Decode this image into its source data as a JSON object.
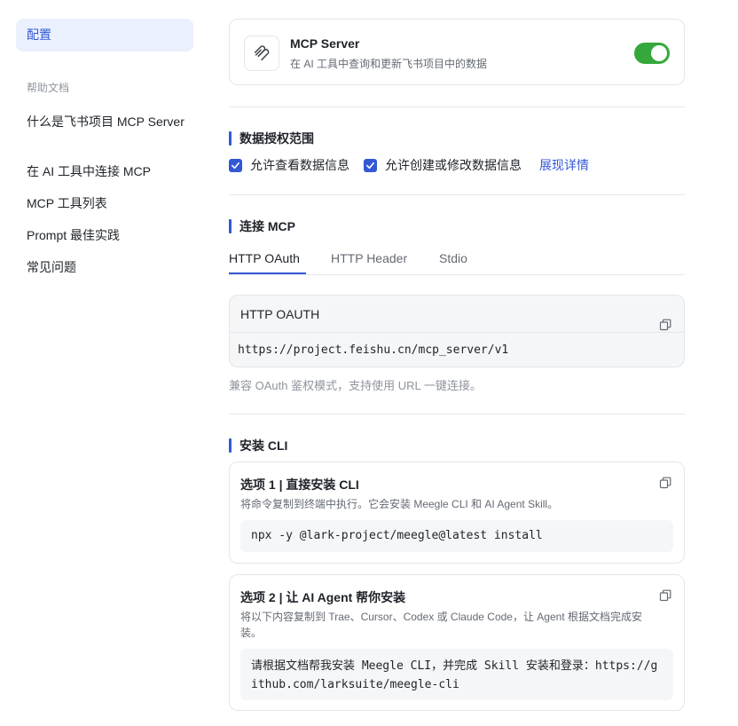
{
  "sidebar": {
    "active_item": "配置",
    "group_title": "帮助文档",
    "items": [
      {
        "label": "什么是飞书项目 MCP Server"
      },
      {
        "label": "在 AI 工具中连接 MCP"
      },
      {
        "label": "MCP 工具列表"
      },
      {
        "label": "Prompt 最佳实践"
      },
      {
        "label": "常见问题"
      }
    ]
  },
  "server": {
    "title": "MCP Server",
    "description": "在 AI 工具中查询和更新飞书项目中的数据",
    "enabled": true
  },
  "permissions": {
    "title": "数据授权范围",
    "read_label": "允许查看数据信息",
    "write_label": "允许创建或修改数据信息",
    "details_link": "展现详情"
  },
  "connect": {
    "title": "连接 MCP",
    "tabs": [
      {
        "label": "HTTP OAuth",
        "active": true
      },
      {
        "label": "HTTP Header",
        "active": false
      },
      {
        "label": "Stdio",
        "active": false
      }
    ],
    "box_title": "HTTP OAUTH",
    "url": "https://project.feishu.cn/mcp_server/v1",
    "hint": "兼容 OAuth 鉴权模式，支持使用 URL 一键连接。"
  },
  "install": {
    "title": "安装 CLI",
    "option1": {
      "title": "选项 1 | 直接安装 CLI",
      "description": "将命令复制到终端中执行。它会安装 Meegle CLI 和 AI Agent Skill。",
      "code": "npx -y @lark-project/meegle@latest install"
    },
    "option2": {
      "title": "选项 2 | 让 AI Agent 帮你安装",
      "description": "将以下内容复制到 Trae、Cursor、Codex 或 Claude Code，让 Agent 根据文档完成安装。",
      "code": "请根据文档帮我安装 Meegle CLI，并完成 Skill 安装和登录：https://github.com/larksuite/meegle-cli"
    }
  },
  "colors": {
    "accent": "#3358d4",
    "toggle_on": "#34a83a"
  }
}
